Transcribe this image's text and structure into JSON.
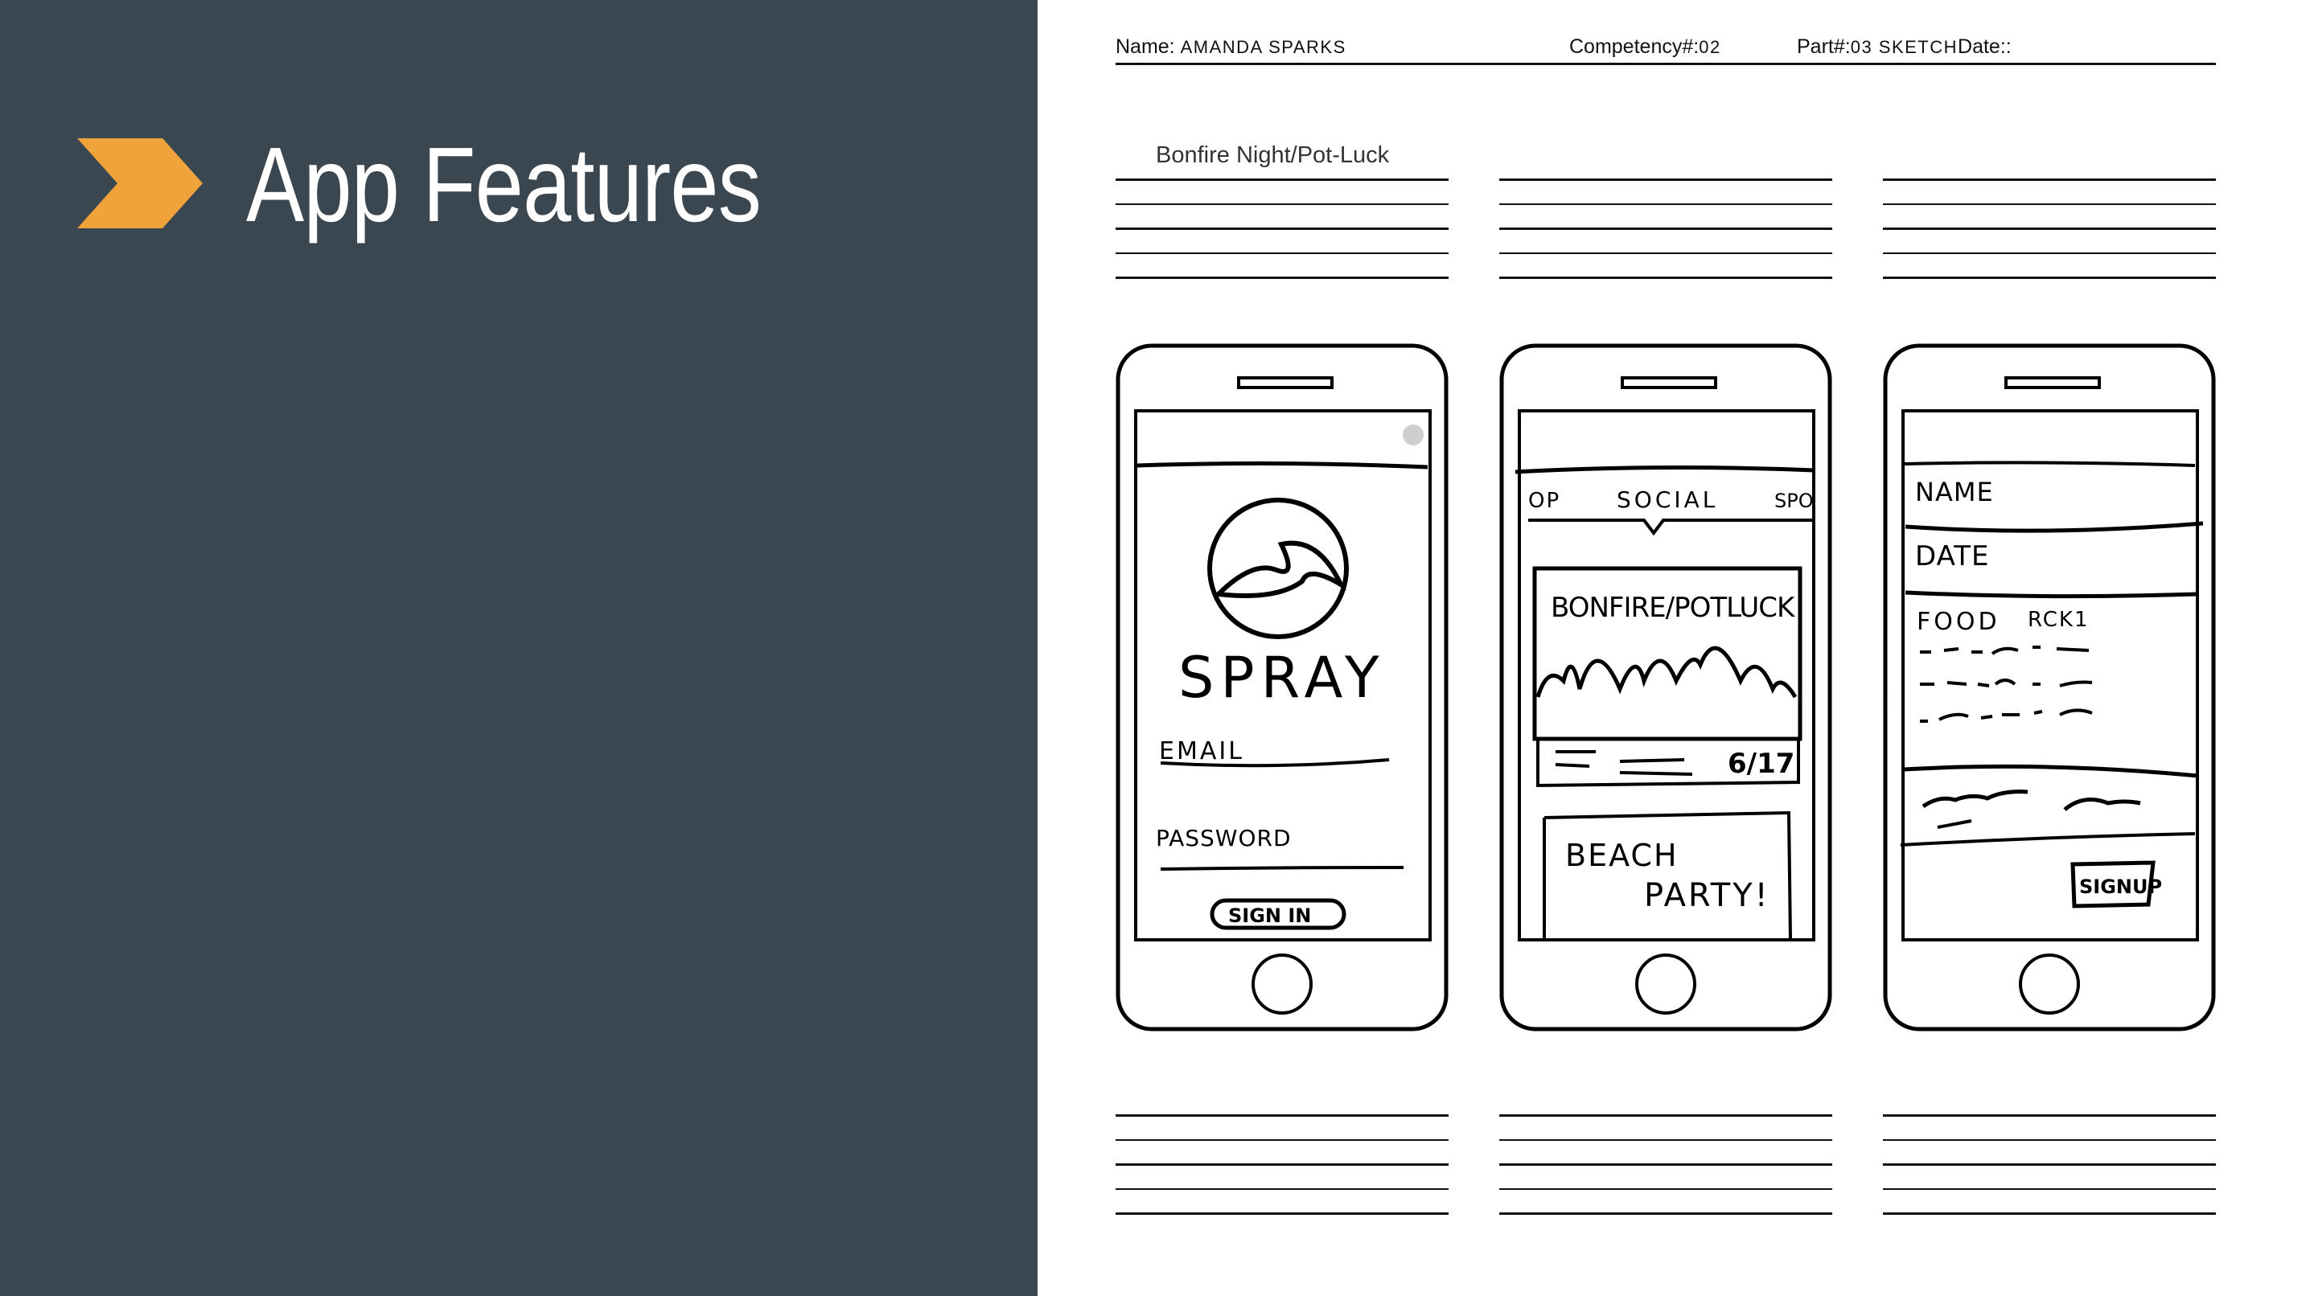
{
  "slide": {
    "title": "App Features"
  },
  "sheet": {
    "name_label": "Name:",
    "name_value": "AMANDA SPARKS",
    "competency_label": "Competency#:",
    "competency_value": "02",
    "part_label": "Part#:",
    "part_value": "03 SKETCH",
    "date_label": "Date::",
    "sketch_title": "Bonfire Night/Pot-Luck"
  },
  "phones": [
    {
      "logo_text": "SPRAY",
      "email_label": "EMAIL",
      "password_label": "PASSWORD",
      "signin_label": "SIGN IN"
    },
    {
      "tabs": [
        "OP",
        "SOCIAL",
        "SPO"
      ],
      "card1_title": "BONFIRE/POTLUCK",
      "card1_date": "6/17",
      "card2_line1": "BEACH",
      "card2_line2": "PARTY!"
    },
    {
      "name_label": "NAME",
      "date_label": "DATE",
      "food_label": "FOOD",
      "rck_label": "RCK1",
      "signup_label": "SIGNUP"
    }
  ],
  "colors": {
    "left_panel": "#3b4750",
    "accent": "#f0a23b",
    "title": "#ffffff"
  }
}
